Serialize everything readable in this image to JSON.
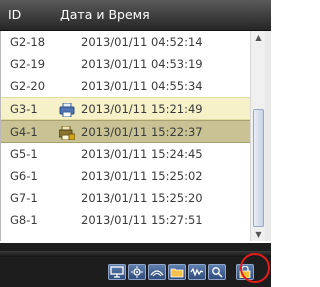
{
  "header": {
    "id_label": "ID",
    "datetime_label": "Дата и Время"
  },
  "rows": [
    {
      "id": "G2-18",
      "datetime": "2013/01/11  04:52:14"
    },
    {
      "id": "G2-19",
      "datetime": "2013/01/11  04:53:19"
    },
    {
      "id": "G2-20",
      "datetime": "2013/01/11  04:55:34"
    },
    {
      "id": "G3-1",
      "datetime": "2013/01/11  15:21:49"
    },
    {
      "id": "G4-1",
      "datetime": "2013/01/11  15:22:37"
    },
    {
      "id": "G5-1",
      "datetime": "2013/01/11  15:24:45"
    },
    {
      "id": "G6-1",
      "datetime": "2013/01/11  15:25:02"
    },
    {
      "id": "G7-1",
      "datetime": "2013/01/11  15:25:20"
    },
    {
      "id": "G8-1",
      "datetime": "2013/01/11  15:27:51"
    }
  ],
  "icons": {
    "row_3": "printer-icon",
    "row_4": "locked-printer-icon"
  },
  "toolbar_icons": [
    "monitor-icon",
    "settings-icon",
    "network-icon",
    "folder-icon",
    "waveform-icon",
    "search-icon",
    "lock-icon"
  ],
  "colors": {
    "header_bg": "#333333",
    "selected_light": "#f6f1c8",
    "selected_dark": "#c9c294",
    "toolbar_bg": "#1d1d1d",
    "highlight_ring": "#e31b1b"
  }
}
